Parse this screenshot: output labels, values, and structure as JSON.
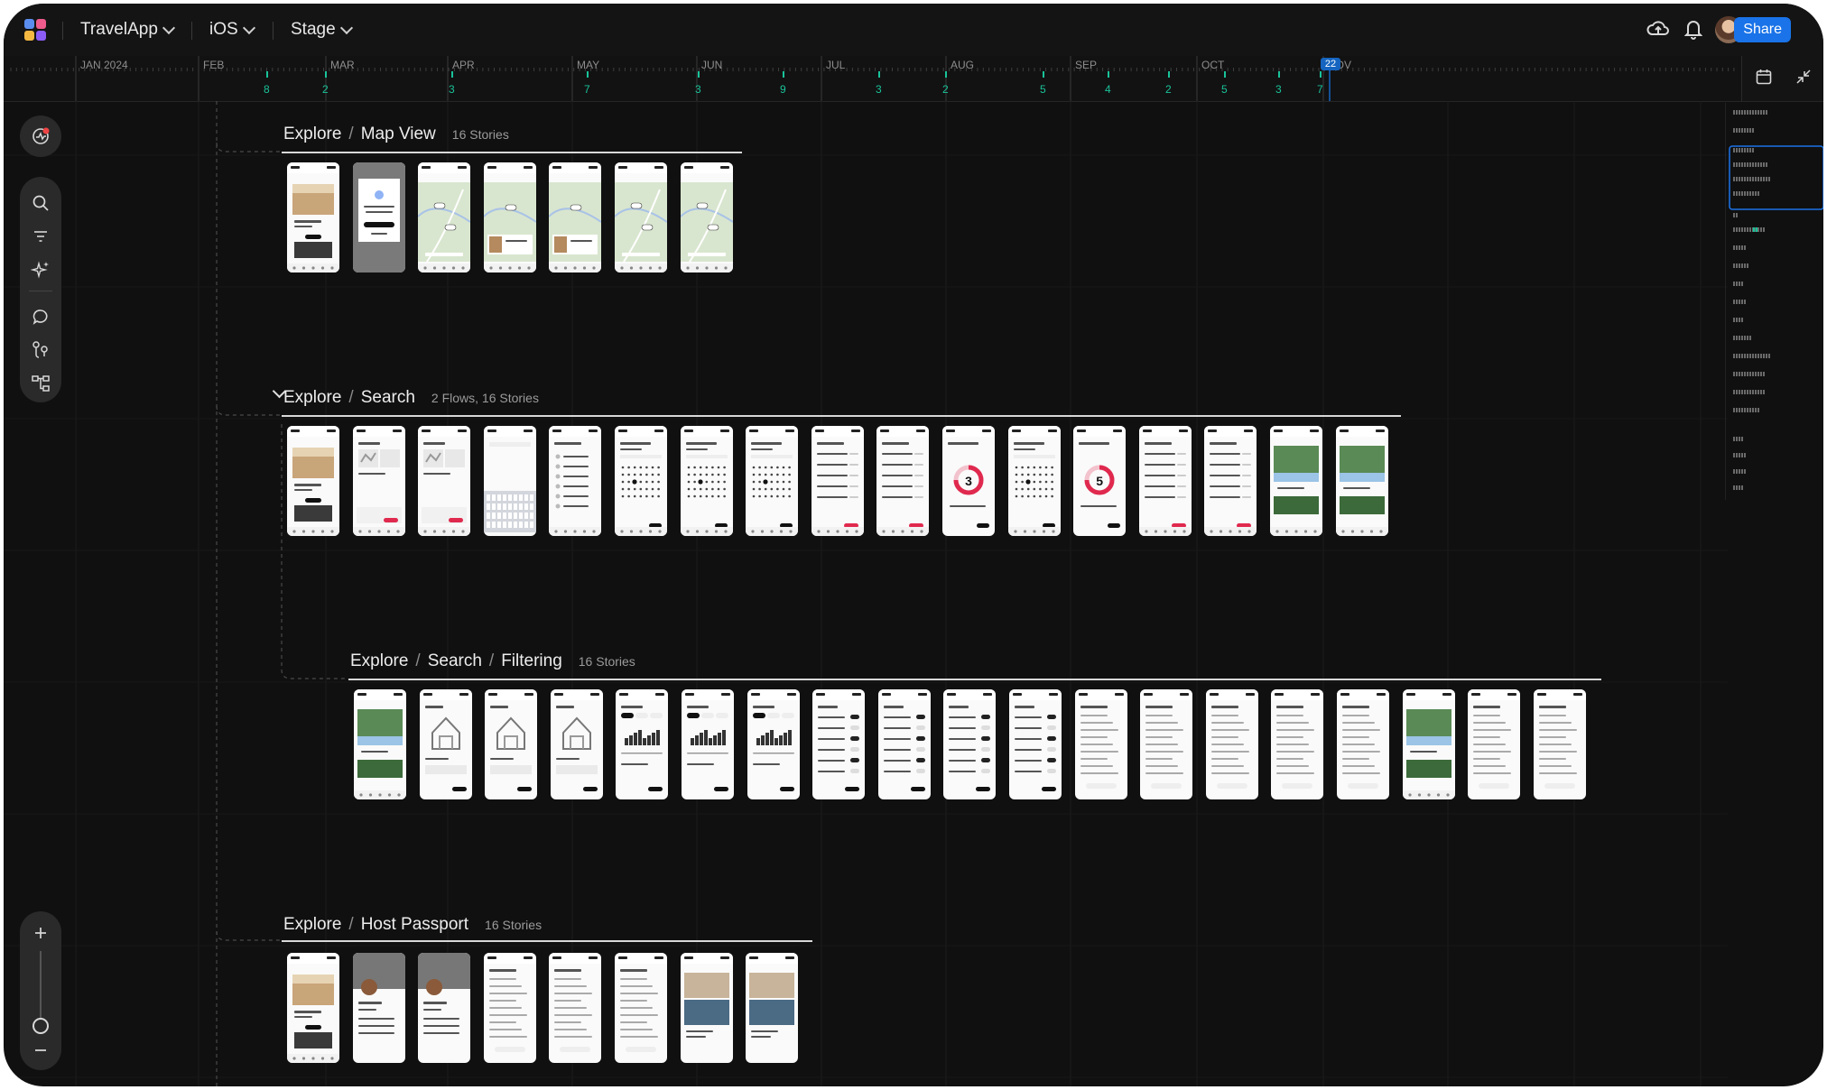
{
  "topbar": {
    "project": "TravelApp",
    "platform": "iOS",
    "environment": "Stage",
    "share_label": "Share"
  },
  "timeline": {
    "months": [
      "JAN 2024",
      "FEB",
      "MAR",
      "APR",
      "MAY",
      "JUN",
      "JUL",
      "AUG",
      "SEP",
      "OCT",
      "NOV"
    ],
    "today_badge": "22",
    "counts": [
      "8",
      "2",
      "3",
      "7",
      "3",
      "9",
      "3",
      "2",
      "5",
      "4",
      "2",
      "5",
      "3",
      "7"
    ]
  },
  "sections": [
    {
      "parts": [
        "Explore",
        "Map View"
      ],
      "stories": "16 Stories",
      "collapsible": false
    },
    {
      "parts": [
        "Explore",
        "Search"
      ],
      "stories": "2 Flows, 16 Stories",
      "collapsible": true
    },
    {
      "parts": [
        "Explore",
        "Search",
        "Filtering"
      ],
      "stories": "16 Stories",
      "collapsible": false
    },
    {
      "parts": [
        "Explore",
        "Host Passport"
      ],
      "stories": "16 Stories",
      "collapsible": false
    }
  ],
  "thumb_badges": {
    "search_a": "3",
    "search_b": "5"
  },
  "colors": {
    "share": "#1a73e8",
    "accent_green": "#19c39a",
    "badge": "#1565c0",
    "canvas": "#101010",
    "toolbar": "#2a2a2a"
  },
  "icons": [
    "logo-icon",
    "cloud-sync-icon",
    "bell-icon",
    "avatar",
    "calendar-icon",
    "collapse-icon",
    "activity-icon",
    "search-icon",
    "filter-icon",
    "sparkle-icon",
    "comment-icon",
    "user-flow-icon",
    "hierarchy-icon",
    "zoom-in-icon",
    "zoom-out-icon"
  ]
}
